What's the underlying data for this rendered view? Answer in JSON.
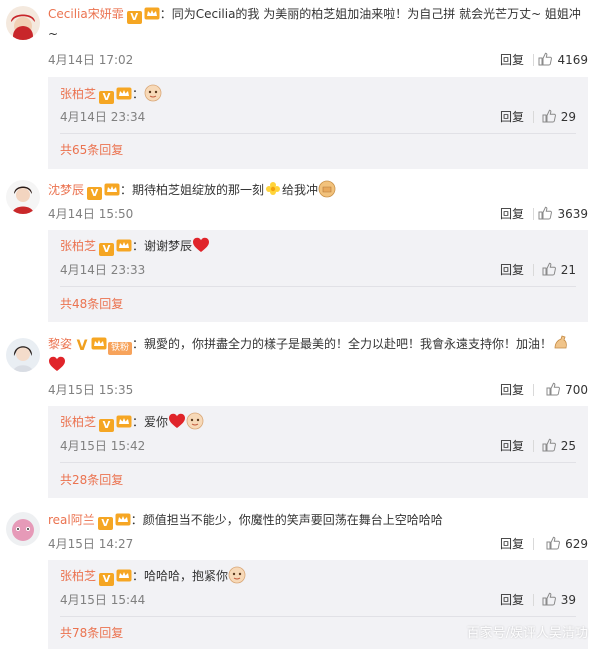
{
  "colors": {
    "username": "#eb7350",
    "reply_bg": "#f2f2f5",
    "time": "#808080"
  },
  "comments": [
    {
      "username": "Cecilia宋妍霏",
      "text": "：同为Cecilia的我 为美丽的柏芝姐加油来啦！为自己拼 就会光芒万丈~ 姐姐冲~",
      "time": "4月14日 17:02",
      "reply_label": "回复",
      "likes": "4169",
      "reply": {
        "username": "张柏芝",
        "text": "：",
        "emoji": "face-emoji",
        "time": "4月14日 23:34",
        "reply_label": "回复",
        "likes": "29"
      },
      "total": "共65条回复"
    },
    {
      "username": "沈梦辰",
      "text": "：期待柏芝姐绽放的那一刻",
      "text2": "给我冲",
      "time": "4月14日 15:50",
      "reply_label": "回复",
      "likes": "3639",
      "reply": {
        "username": "张柏芝",
        "text": "：谢谢梦辰",
        "emoji": "heart-emoji",
        "time": "4月14日 23:33",
        "reply_label": "回复",
        "likes": "21"
      },
      "total": "共48条回复"
    },
    {
      "username": "黎姿",
      "fan_badge": "铁粉",
      "text": "：親愛的，你拼盡全力的樣子是最美的！全力以赴吧！我會永遠支持你！加油！",
      "time": "4月15日 15:35",
      "reply_label": "回复",
      "likes": "700",
      "reply": {
        "username": "张柏芝",
        "text": "：爱你",
        "emoji": "heart-emoji",
        "time": "4月15日 15:42",
        "reply_label": "回复",
        "likes": "25"
      },
      "total": "共28条回复"
    },
    {
      "username": "real阿兰",
      "text": "：颜值担当不能少，你魔性的笑声要回荡在舞台上空哈哈哈",
      "time": "4月15日 14:27",
      "reply_label": "回复",
      "likes": "629",
      "reply": {
        "username": "张柏芝",
        "text": "：哈哈哈，抱紧你",
        "emoji": "face-emoji",
        "time": "4月15日 15:44",
        "reply_label": "回复",
        "likes": "39"
      },
      "total": "共78条回复"
    }
  ],
  "watermark": "百家号/娱评人吴清功"
}
